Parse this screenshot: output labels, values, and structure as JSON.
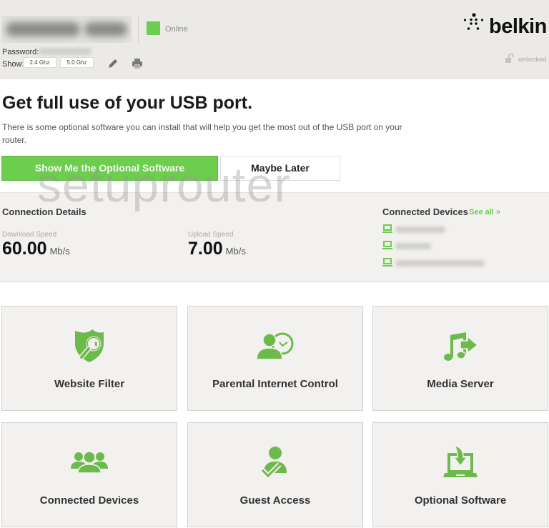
{
  "header": {
    "network_name": "(blurred)",
    "status": "Online",
    "status_color": "#6ccd4e",
    "password_label": "Password:",
    "show_label": "Show:",
    "bands": [
      "2.4 Ghz",
      "5.0 Ghz"
    ],
    "brand": "belkin",
    "lock_status": "unlocked"
  },
  "promo": {
    "title": "Get full use of your USB port.",
    "description": "There is some optional software you can install that will help you get the most out of the USB port on your router.",
    "primary_button": "Show Me the Optional Software",
    "secondary_button": "Maybe Later"
  },
  "connection": {
    "title": "Connection Details",
    "download_label": "Download Speed",
    "download_value": "60.00",
    "download_unit": "Mb/s",
    "upload_label": "Upload Speed",
    "upload_value": "7.00",
    "upload_unit": "Mb/s"
  },
  "devices": {
    "title": "Connected Devices",
    "see_all": "See all »",
    "items": [
      "(blurred)",
      "(blurred)",
      "(blurred)"
    ]
  },
  "tiles": [
    {
      "label": "Website Filter",
      "icon": "shield-search-icon"
    },
    {
      "label": "Parental Internet Control",
      "icon": "user-clock-icon"
    },
    {
      "label": "Media Server",
      "icon": "music-arrow-icon"
    },
    {
      "label": "Connected Devices",
      "icon": "users-group-icon"
    },
    {
      "label": "Guest Access",
      "icon": "user-check-icon"
    },
    {
      "label": "Optional Software",
      "icon": "laptop-download-icon"
    }
  ],
  "watermark": "setuprouter",
  "accent_color": "#6ccd4e"
}
